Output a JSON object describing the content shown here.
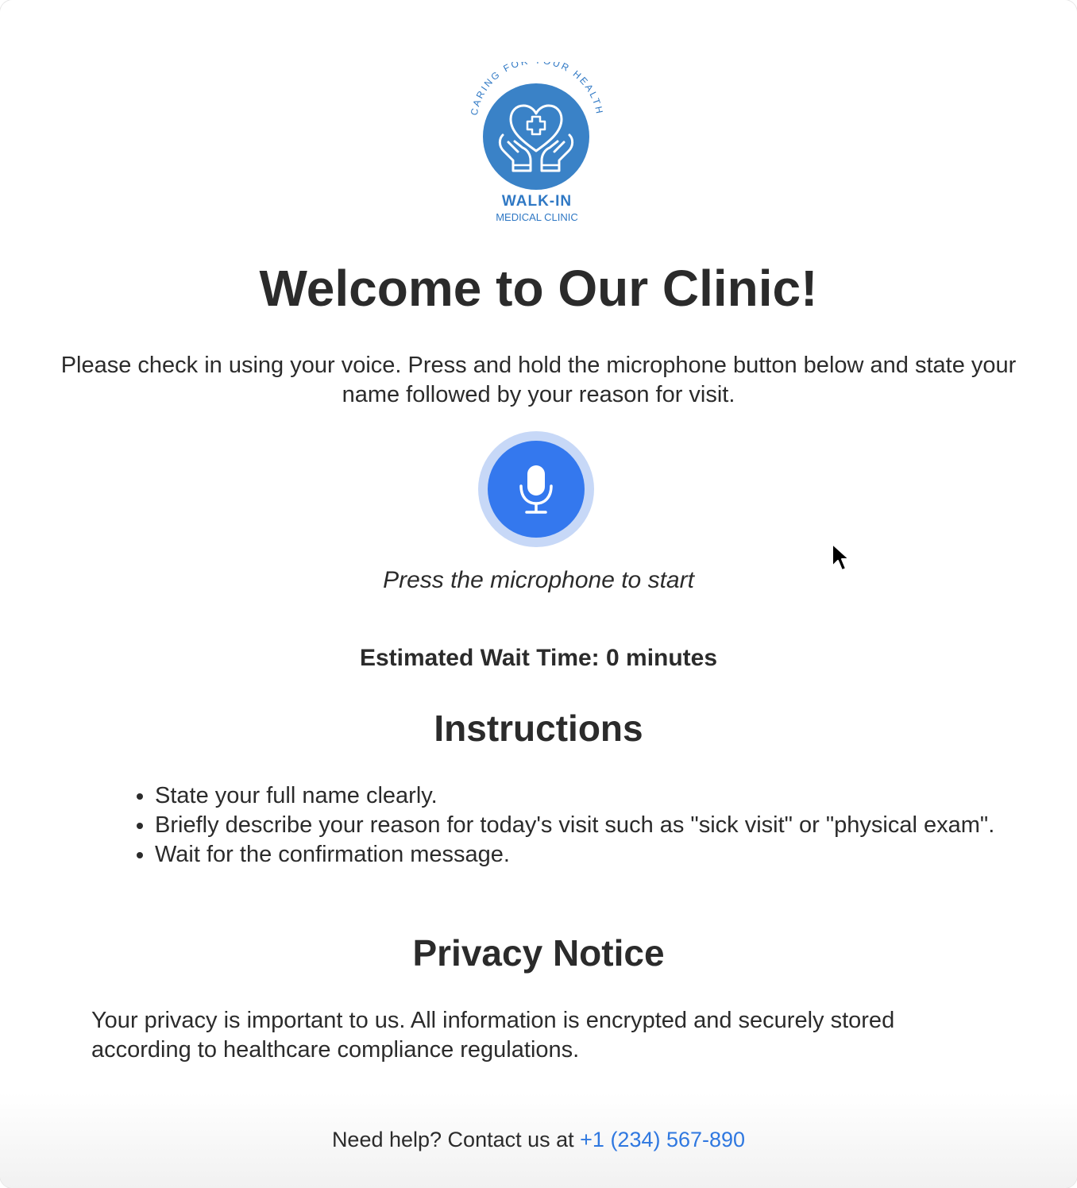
{
  "logo": {
    "arc_text": "CARING FOR YOUR HEALTH",
    "title": "WALK-IN",
    "subtitle": "MEDICAL CLINIC",
    "icon": "heart-hands-cross-icon",
    "color": "#2f78c4"
  },
  "heading": "Welcome to Our Clinic!",
  "intro": "Please check in using your voice. Press and hold the microphone button below and state your name followed by your reason for visit.",
  "microphone": {
    "icon": "microphone-icon",
    "status": "Press the microphone to start",
    "color": "#3478ee",
    "halo_color": "#c7d8f7"
  },
  "wait_time": "Estimated Wait Time: 0 minutes",
  "instructions": {
    "title": "Instructions",
    "items": [
      "State your full name clearly.",
      "Briefly describe your reason for today's visit such as \"sick visit\" or \"physical exam\".",
      "Wait for the confirmation message."
    ]
  },
  "privacy": {
    "title": "Privacy Notice",
    "text": "Your privacy is important to us. All information is encrypted and securely stored according to healthcare compliance regulations."
  },
  "help": {
    "prefix": "Need help? Contact us at",
    "phone": "+1 (234) 567-890",
    "link_color": "#2f78e0"
  }
}
